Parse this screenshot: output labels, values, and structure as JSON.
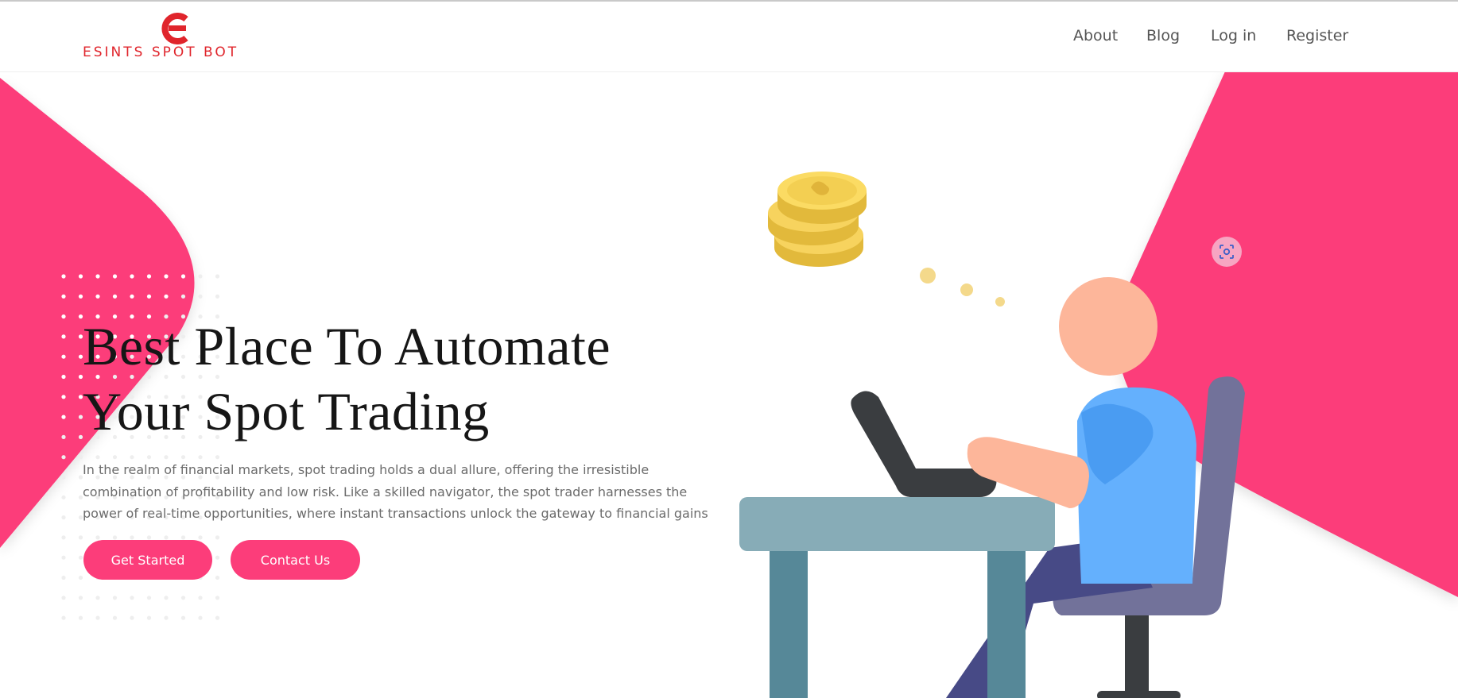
{
  "brand": {
    "name": "ESINTS SPOT BOT",
    "color": "#e0252c",
    "logo_icon": "esints-logo-icon"
  },
  "nav": {
    "items": [
      {
        "label": "About"
      },
      {
        "label": "Blog"
      },
      {
        "label": "Log in"
      },
      {
        "label": "Register"
      }
    ]
  },
  "hero": {
    "title_line1": "Best Place To Automate",
    "title_line2": "Your Spot Trading",
    "description": "In the realm of financial markets, spot trading holds a dual allure, offering the irresistible combination of profitability and low risk. Like a skilled navigator, the spot trader harnesses the power of real-time opportunities, where instant transactions unlock the gateway to financial gains",
    "buttons": {
      "primary": "Get Started",
      "secondary": "Contact Us"
    },
    "illustration": "person-trading-on-laptop-illustration",
    "floating_icon": "screenshot-focus-icon"
  },
  "colors": {
    "accent": "#fc3d7a",
    "title": "#161616",
    "text": "#6b6b6b",
    "nav": "#555555"
  }
}
